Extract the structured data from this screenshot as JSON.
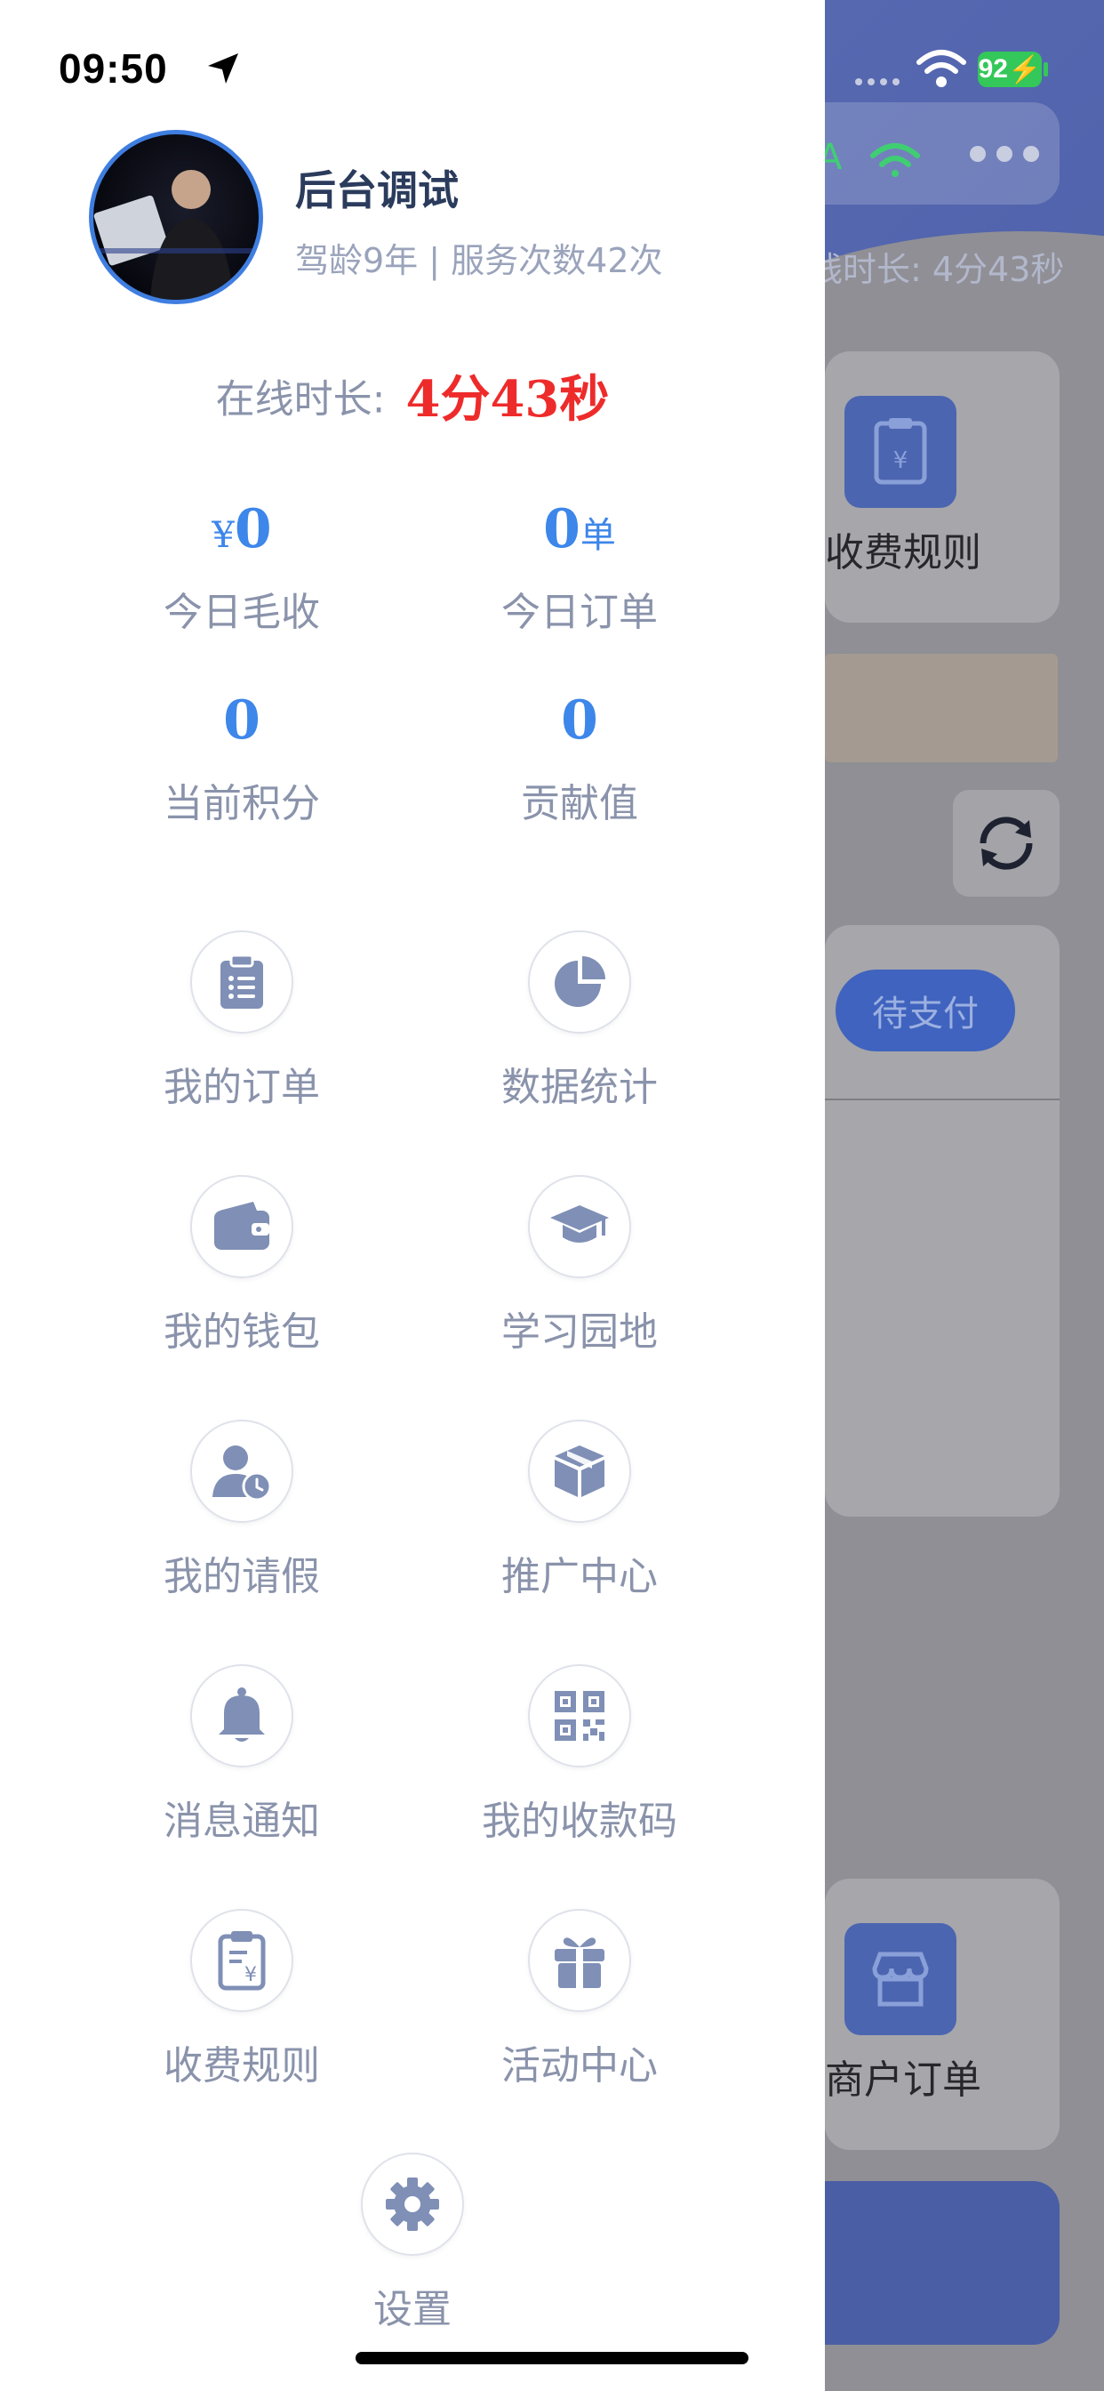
{
  "status_bar": {
    "time": "09:50",
    "battery": "92"
  },
  "background": {
    "online_text": "线时长: 4分43秒",
    "fee_rules": "收费规则",
    "pay_button": "待支付",
    "merchant_orders": "商户订单"
  },
  "drawer": {
    "user": {
      "name": "后台调试",
      "subtitle": "驾龄9年 | 服务次数42次"
    },
    "online": {
      "label": "在线时长:",
      "value": "4分43秒"
    },
    "stats": [
      {
        "prefix": "¥",
        "value": "0",
        "suffix": "",
        "label": "今日毛收"
      },
      {
        "prefix": "",
        "value": "0",
        "suffix": "单",
        "label": "今日订单"
      },
      {
        "prefix": "",
        "value": "0",
        "suffix": "",
        "label": "当前积分"
      },
      {
        "prefix": "",
        "value": "0",
        "suffix": "",
        "label": "贡献值"
      }
    ],
    "menu": [
      {
        "icon": "clipboard-list-icon",
        "label": "我的订单"
      },
      {
        "icon": "pie-chart-icon",
        "label": "数据统计"
      },
      {
        "icon": "wallet-icon",
        "label": "我的钱包"
      },
      {
        "icon": "graduation-cap-icon",
        "label": "学习园地"
      },
      {
        "icon": "user-clock-icon",
        "label": "我的请假"
      },
      {
        "icon": "box-icon",
        "label": "推广中心"
      },
      {
        "icon": "bell-icon",
        "label": "消息通知"
      },
      {
        "icon": "qr-code-icon",
        "label": "我的收款码"
      },
      {
        "icon": "fee-document-icon",
        "label": "收费规则"
      },
      {
        "icon": "gift-icon",
        "label": "活动中心"
      }
    ],
    "settings": {
      "icon": "gear-icon",
      "label": "设置"
    }
  },
  "colors": {
    "accent": "#3d86ea",
    "online_value": "#ee2b2b",
    "icon": "#7f8fb5"
  }
}
